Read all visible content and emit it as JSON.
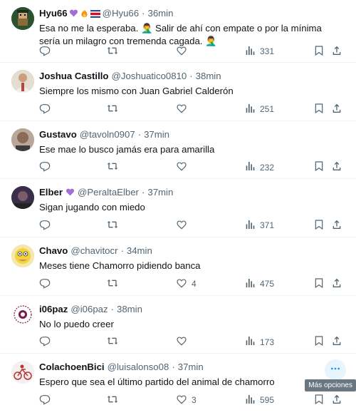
{
  "tweets": [
    {
      "name": "Hyu66",
      "handle": "@Hyu66",
      "time": "36min",
      "text": "Esa no me la esperaba. 🤦‍♂️ Salir de ahí con empate o por la mínima sería un milagro con tremenda cagada. 🤦‍♂️",
      "likes": "",
      "views": "331",
      "avatar_color": "#3b6b3a"
    },
    {
      "name": "Joshua Castillo",
      "handle": "@Joshuatico0810",
      "time": "38min",
      "text": "Siempre los mismo con Juan Gabriel Calderón",
      "likes": "",
      "views": "251",
      "avatar_color": "#c9b89a"
    },
    {
      "name": "Gustavo",
      "handle": "@tavoln0907",
      "time": "37min",
      "text": "Ese mae lo busco jamás era para amarilla",
      "likes": "",
      "views": "232",
      "avatar_color": "#a58a78"
    },
    {
      "name": "Elber",
      "handle": "@PeraltaElber",
      "time": "37min",
      "text": "Sigan jugando con miedo",
      "likes": "",
      "views": "371",
      "avatar_color": "#5a4a6a"
    },
    {
      "name": "Chavo",
      "handle": "@chavitocr",
      "time": "34min",
      "text": "Meses tiene Chamorro pidiendo banca",
      "likes": "4",
      "views": "475",
      "avatar_color": "#e8c542"
    },
    {
      "name": "i06paz",
      "handle": "@i06paz",
      "time": "38min",
      "text": "No lo puedo creer",
      "likes": "",
      "views": "173",
      "avatar_color": "#f2e8ee"
    },
    {
      "name": "ColachoenBici",
      "handle": "@luisalonso08",
      "time": "37min",
      "text": "Espero que sea el último partido del animal de chamorro",
      "likes": "3",
      "views": "595",
      "avatar_color": "#e9e4e4"
    }
  ],
  "tooltip": "Más opciones",
  "colors": {
    "secondary_text": "#536471",
    "divider": "#eff3f4",
    "purple_heart": "#a46cd8",
    "accent": "#1d9bf0"
  },
  "icons": [
    "reply-icon",
    "retweet-icon",
    "like-icon",
    "views-icon",
    "bookmark-icon",
    "share-icon",
    "more-icon"
  ]
}
